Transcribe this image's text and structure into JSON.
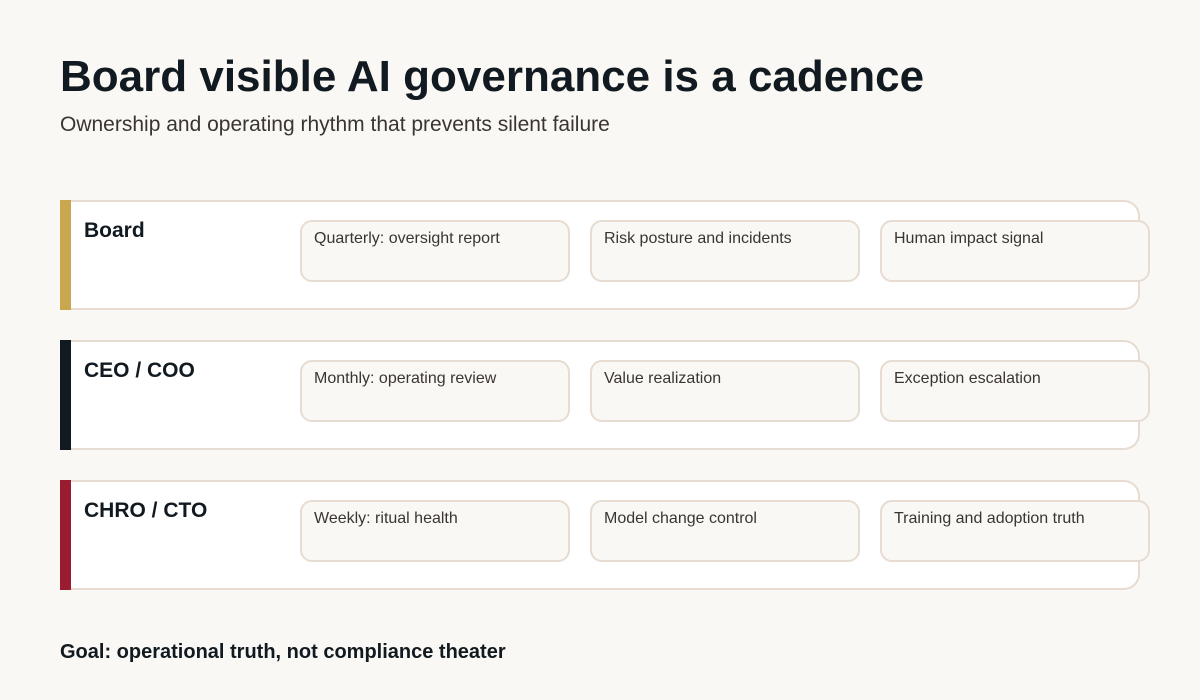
{
  "title": "Board visible AI governance is a cadence",
  "subtitle": "Ownership and operating rhythm that prevents silent failure",
  "rows": [
    {
      "role": "Board",
      "accent_color": "#c8a74f",
      "items": [
        "Quarterly: oversight report",
        "Risk posture and incidents",
        "Human impact signal"
      ]
    },
    {
      "role": "CEO / COO",
      "accent_color": "#121a21",
      "items": [
        "Monthly: operating review",
        "Value realization",
        "Exception escalation"
      ]
    },
    {
      "role": "CHRO / CTO",
      "accent_color": "#9b1c31",
      "items": [
        "Weekly: ritual health",
        "Model change control",
        "Training and adoption truth"
      ]
    }
  ],
  "footer": "Goal: operational truth, not compliance theater",
  "colors": {
    "background": "#faf8f4",
    "card_border": "#e6dcd1",
    "text_dark": "#121a21",
    "text_muted": "#3a3532"
  }
}
